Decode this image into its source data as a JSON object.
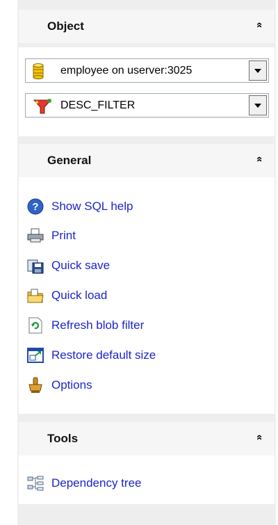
{
  "object": {
    "title": "Object",
    "collapse_glyph": "»",
    "database_combo": {
      "value": "employee on userver:3025",
      "icon": "database-icon"
    },
    "filter_combo": {
      "value": "DESC_FILTER",
      "icon": "filter-icon"
    }
  },
  "general": {
    "title": "General",
    "collapse_glyph": "»",
    "items": [
      {
        "label": "Show SQL help",
        "icon": "help-icon"
      },
      {
        "label": "Print",
        "icon": "printer-icon"
      },
      {
        "label": "Quick save",
        "icon": "save-icon"
      },
      {
        "label": "Quick load",
        "icon": "load-icon"
      },
      {
        "label": "Refresh blob filter",
        "icon": "refresh-icon"
      },
      {
        "label": "Restore default size",
        "icon": "restore-size-icon"
      },
      {
        "label": "Options",
        "icon": "options-icon"
      }
    ]
  },
  "tools": {
    "title": "Tools",
    "collapse_glyph": "»",
    "items": [
      {
        "label": "Dependency tree",
        "icon": "dependency-tree-icon"
      }
    ]
  },
  "colors": {
    "link": "#1c24c8",
    "panel_bg": "#eeeeee",
    "header_bg": "#f6f6f6"
  }
}
